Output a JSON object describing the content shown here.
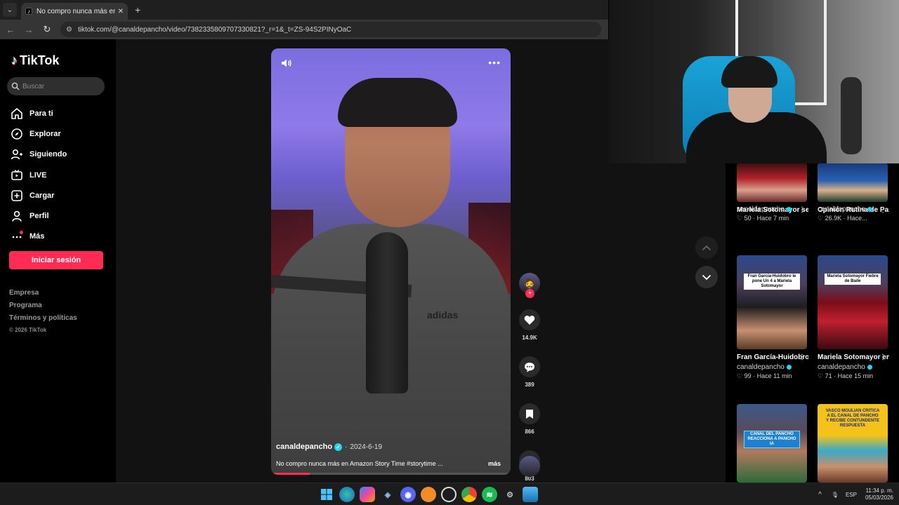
{
  "browser": {
    "tab_title": "No compro nunca más en Amazon Story Time",
    "tab_favicon": "tiktok-icon",
    "url": "tiktok.com/@canaldepancho/video/7382335809707330821?_r=1&_t=ZS-94S2PINyOaC"
  },
  "sidebar": {
    "logo": "TikTok",
    "search_placeholder": "Buscar",
    "menu": [
      {
        "label": "Para ti",
        "icon": "home-icon"
      },
      {
        "label": "Explorar",
        "icon": "compass-icon"
      },
      {
        "label": "Siguiendo",
        "icon": "following-icon"
      },
      {
        "label": "LIVE",
        "icon": "live-icon"
      },
      {
        "label": "Cargar",
        "icon": "upload-icon"
      },
      {
        "label": "Perfil",
        "icon": "profile-icon"
      },
      {
        "label": "Más",
        "icon": "more-icon"
      }
    ],
    "login_button": "Iniciar sesión",
    "footer": [
      "Empresa",
      "Programa",
      "Términos y políticas"
    ],
    "copyright": "© 2026 TikTok"
  },
  "video": {
    "author": "canaldepancho",
    "date": "2024-6-19",
    "date_prefix": "·",
    "description": "No compro nunca más en Amazon Story Time #storytime ...",
    "more_label": "más",
    "overlay_text": "adidas",
    "progress": 0.16
  },
  "actions": {
    "likes": "14.9K",
    "comments": "389",
    "saves": "866",
    "shares": "803"
  },
  "related": [
    {
      "title": "Mariela Sotomayor se emociona por...",
      "author": "canaldepancho",
      "likes": "50",
      "time": "Hace 7 min"
    },
    {
      "title": "Opinión Rutina de Pastor Rocha en...",
      "author": "canaldepancho",
      "likes": "26.9K",
      "time": "Hace..."
    },
    {
      "title": "Fran García-Huidobro le pone...",
      "author": "canaldepancho",
      "likes": "99",
      "time": "Hace 11 min",
      "caption": "Fran García-Huidobro le pone Un 4 a Mariela Sotomayor"
    },
    {
      "title": "Mariela Sotomayor en Fiebre de Bail...",
      "author": "canaldepancho",
      "likes": "71",
      "time": "Hace 15 min",
      "caption": "Mariela Sotomayor Fiebre de Baile"
    },
    {
      "title": "",
      "author": "",
      "likes": "",
      "time": "",
      "caption": "CANAL DEL PANCHO REACCIONA A PANCHO IA"
    },
    {
      "title": "",
      "author": "",
      "likes": "",
      "time": "",
      "caption": "VASCO MOULIAN CRITICA A EL CANAL DE PANCHO Y RECIBE CONTUNDENTE RESPUESTA"
    }
  ],
  "taskbar": {
    "apps": [
      "windows-start-icon",
      "edge-icon",
      "copilot-icon",
      "app-icon",
      "discord-icon",
      "fl-studio-icon",
      "obs-icon",
      "chrome-icon",
      "spotify-icon",
      "settings-icon",
      "photos-icon"
    ],
    "lang": "ESP",
    "time": "11:34 p. m.",
    "date": "05/03/2026"
  },
  "colors": {
    "accent": "#fe2c55",
    "verified": "#20d5ec"
  }
}
